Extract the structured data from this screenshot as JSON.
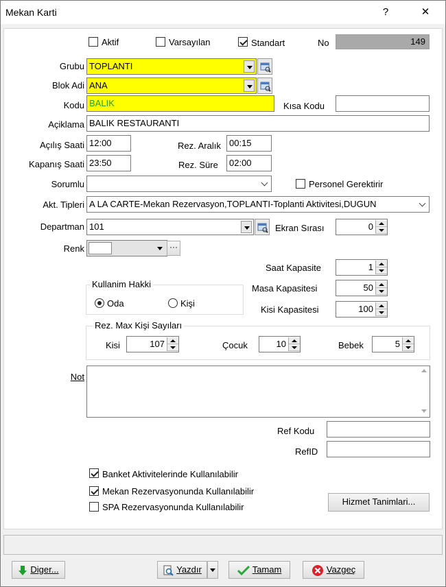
{
  "window": {
    "title": "Mekan Karti",
    "help_glyph": "?",
    "close_glyph": "✕"
  },
  "flags": {
    "aktif": "Aktif",
    "varsayilan": "Varsayılan",
    "standart": "Standart",
    "no_label": "No",
    "no_value": "149"
  },
  "fields": {
    "grubu_label": "Grubu",
    "grubu_value": "TOPLANTI",
    "blok_label": "Blok Adi",
    "blok_value": "ANA",
    "kodu_label": "Kodu",
    "kodu_value": "BALIK",
    "kisa_kodu_label": "Kısa Kodu",
    "kisa_kodu_value": "",
    "aciklama_label": "Açiklama",
    "aciklama_value": "BALIK RESTAURANTI",
    "acilis_label": "Açılış Saati",
    "acilis_value": "12:00",
    "rez_aralik_label": "Rez. Aralık",
    "rez_aralik_value": "00:15",
    "kapanis_label": "Kapanış Saati",
    "kapanis_value": "23:50",
    "rez_sure_label": "Rez. Süre",
    "rez_sure_value": "02:00",
    "sorumlu_label": "Sorumlu",
    "sorumlu_value": "",
    "personel_label": "Personel Gerektirir",
    "akt_tipleri_label": "Akt. Tipleri",
    "akt_tipleri_value": "A LA CARTE-Mekan Rezervasyon,TOPLANTI-Toplanti Aktivitesi,DUGUN",
    "departman_label": "Departman",
    "departman_value": "101",
    "ekran_sirasi_label": "Ekran Sırası",
    "ekran_sirasi_value": "0",
    "renk_label": "Renk",
    "renk_more": "···"
  },
  "capacity": {
    "saat_label": "Saat Kapasite",
    "saat_value": "1",
    "masa_label": "Masa Kapasitesi",
    "masa_value": "50",
    "kisi_label": "Kisi Kapasitesi",
    "kisi_value": "100"
  },
  "kullanim": {
    "title": "Kullanim Hakki",
    "oda": "Oda",
    "kisi": "Kişi"
  },
  "rezmax": {
    "title": "Rez. Max Kişi Sayıları",
    "kisi_label": "Kisi",
    "kisi_value": "107",
    "cocuk_label": "Çocuk",
    "cocuk_value": "10",
    "bebek_label": "Bebek",
    "bebek_value": "5"
  },
  "not_label": "Not",
  "ref": {
    "kodu_label": "Ref Kodu",
    "kodu_value": "",
    "id_label": "RefID",
    "id_value": ""
  },
  "options": {
    "banket": "Banket Aktivitelerinde Kullanılabilir",
    "mekan": "Mekan Rezervasyonunda Kullanılabilir",
    "spa": "SPA Rezervasyonunda Kullanılabilir"
  },
  "buttons": {
    "hizmet": "Hizmet Tanimlari...",
    "diger": "Diger...",
    "yazdir": "Yazdır",
    "tamam": "Tamam",
    "vazgec": "Vazgeç"
  }
}
